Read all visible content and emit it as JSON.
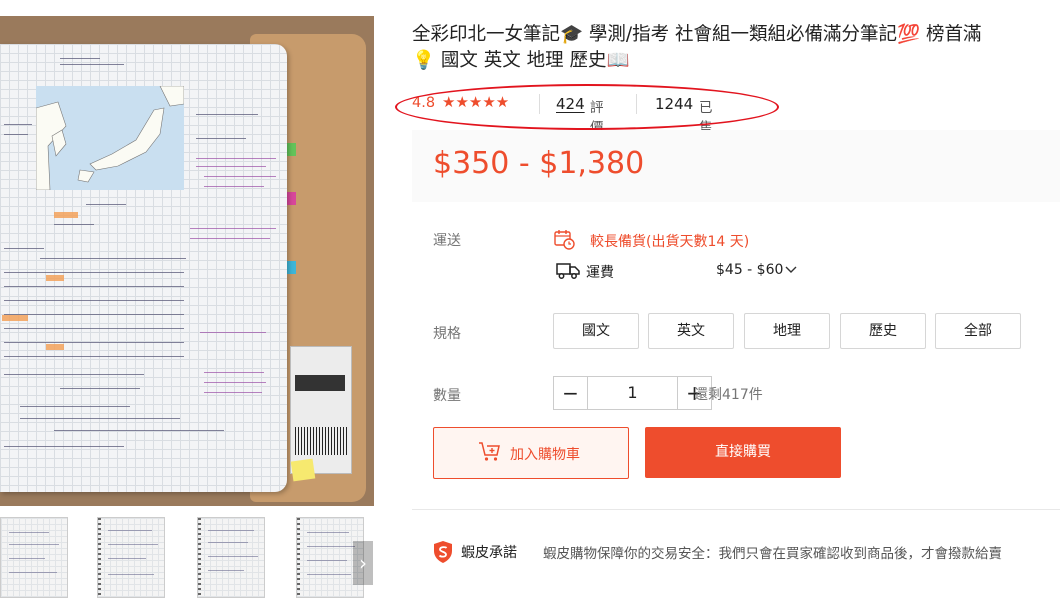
{
  "product": {
    "title_line1": "全彩印北一女筆記🎓 學測/指考 社會組一類組必備滿分筆記💯 榜首滿",
    "title_line2": "💡 國文 英文 地理 歷史📖"
  },
  "rating": {
    "score": "4.8",
    "stars": "★★★★★",
    "review_count": "424",
    "review_label": "評價",
    "sold_count": "1244",
    "sold_label": "已售出"
  },
  "price": {
    "range": "$350 - $1,380"
  },
  "shipping": {
    "label": "運送",
    "preorder_text": "較長備貨(出貨天數14 天)",
    "fee_label": "運費",
    "fee_value": "$45 - $60"
  },
  "variation": {
    "label": "規格",
    "options": [
      "國文",
      "英文",
      "地理",
      "歷史",
      "全部"
    ]
  },
  "quantity": {
    "label": "數量",
    "value": "1",
    "minus": "−",
    "plus": "+",
    "stock_text": "還剩417件"
  },
  "actions": {
    "add_to_cart": "加入購物車",
    "buy_now": "直接購買"
  },
  "guarantee": {
    "title": "蝦皮承諾",
    "text": "蝦皮購物保障你的交易安全：我們只會在買家確認收到商品後，才會撥款給賣"
  },
  "gallery": {
    "next_arrow": "›"
  },
  "colors": {
    "accent": "#ee4d2d",
    "annotation_oval": "#e2141e"
  }
}
